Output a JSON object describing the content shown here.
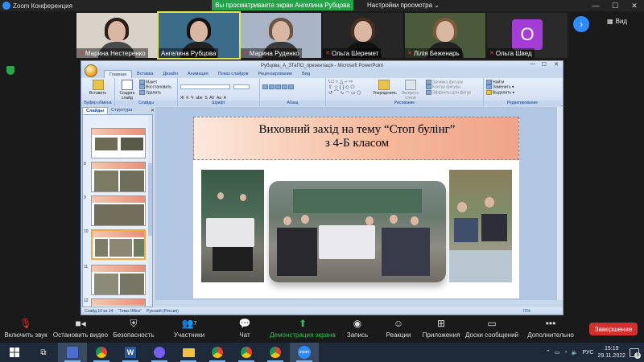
{
  "zoom": {
    "window_title": "Zoom Конференция",
    "share_banner": "Вы просматриваете экран Ангелина Рубцова",
    "view_settings": "Настройки просмотра",
    "view_label": "Вид",
    "participants": [
      {
        "name": "Марина Нестеренко",
        "muted": true
      },
      {
        "name": "Ангелина Рубцова",
        "muted": false,
        "active": true
      },
      {
        "name": "Марина Руденко",
        "muted": true
      },
      {
        "name": "Ольга Шеремет",
        "muted": true
      },
      {
        "name": "Лілія Беженарь",
        "muted": true
      },
      {
        "name": "Ольга Швед",
        "muted": true,
        "avatar_letter": "О"
      }
    ],
    "toolbar": {
      "audio": "Включить звук",
      "video": "Остановить видео",
      "security": "Безопасность",
      "participants": "Участники",
      "participants_count": "7",
      "chat": "Чат",
      "share": "Демонстрация экрана",
      "record": "Запись",
      "reactions": "Реакции",
      "apps": "Приложения",
      "whiteboards": "Доски сообщений",
      "more": "Дополнительно",
      "end": "Завершение"
    }
  },
  "powerpoint": {
    "title": "Рубцова_А_ЗТаПО_презентація - Microsoft PowerPoint",
    "tabs": [
      "Главная",
      "Вставка",
      "Дизайн",
      "Анимация",
      "Показ слайдов",
      "Рецензирование",
      "Вид"
    ],
    "ribbon": {
      "clipboard": {
        "label": "Буфер обмена",
        "paste": "Вставить"
      },
      "slides": {
        "label": "Слайды",
        "new_slide": "Создать слайд",
        "layout": "Макет",
        "reset": "Восстановить",
        "delete": "Удалить"
      },
      "font": {
        "label": "Шрифт"
      },
      "paragraph": {
        "label": "Абзац"
      },
      "drawing": {
        "label": "Рисование",
        "arrange": "Упорядочить",
        "quick_styles": "Экспресс-стили",
        "fill": "Заливка фигуры",
        "outline": "Контур фигуры",
        "effects": "Эффекты для фигур"
      },
      "editing": {
        "label": "Редактирование",
        "find": "Найти",
        "replace": "Заменить",
        "select": "Выделить"
      }
    },
    "panel_tabs": [
      "Слайды",
      "Структура"
    ],
    "thumb_numbers": [
      "",
      "8",
      "9",
      "10",
      "11",
      "12"
    ],
    "slide": {
      "title_line1": "Виховний  захід на тему “Стоп булінг”",
      "title_line2": "з 4-Б класом"
    },
    "status": {
      "slide_pos": "Слайд 10 из 14",
      "theme": "\"Тема Office\"",
      "language": "Русский (Россия)",
      "zoom": "72%"
    }
  },
  "taskbar": {
    "language": "РУС",
    "time": "15:19",
    "date": "29.11.2022",
    "notifications": "3"
  }
}
